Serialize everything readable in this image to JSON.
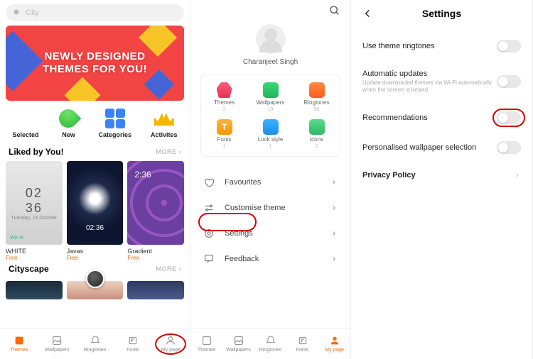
{
  "pane1": {
    "search_placeholder": "City",
    "banner_line1": "NEWLY DESIGNED",
    "banner_line2": "THEMES FOR YOU!",
    "cats": [
      {
        "label": "Selected"
      },
      {
        "label": "New"
      },
      {
        "label": "Categories"
      },
      {
        "label": "Activites"
      }
    ],
    "section1_title": "Liked by You!",
    "more": "MORE",
    "themes": [
      {
        "name": "WHITE",
        "price": "Free",
        "hint": "Win in"
      },
      {
        "name": "Javas",
        "price": "Free"
      },
      {
        "name": "Gradient",
        "price": "Free"
      }
    ],
    "section2_title": "Cityscape",
    "tabs": [
      {
        "label": "Themes"
      },
      {
        "label": "Wallpapers"
      },
      {
        "label": "Ringtones"
      },
      {
        "label": "Fonts"
      },
      {
        "label": "My page"
      }
    ]
  },
  "pane2": {
    "username": "Charanjeet Singh",
    "stats": [
      {
        "label": "Themes",
        "count": "3"
      },
      {
        "label": "Wallpapers",
        "count": "19"
      },
      {
        "label": "Ringtones",
        "count": "56"
      },
      {
        "label": "Fonts",
        "count": "1"
      },
      {
        "label": "Lock style",
        "count": "1"
      },
      {
        "label": "Icons",
        "count": "2"
      }
    ],
    "menu": [
      {
        "label": "Favourites"
      },
      {
        "label": "Customise theme"
      },
      {
        "label": "Settings"
      },
      {
        "label": "Feedback"
      }
    ],
    "tabs": [
      {
        "label": "Themes"
      },
      {
        "label": "Wallpapers"
      },
      {
        "label": "Ringtones"
      },
      {
        "label": "Fonts"
      },
      {
        "label": "My page"
      }
    ]
  },
  "pane3": {
    "title": "Settings",
    "rows": [
      {
        "label": "Use theme ringtones"
      },
      {
        "label": "Automatic updates",
        "sub": "Update downloaded themes via Wi-Fi automatically when the screen is locked"
      },
      {
        "label": "Recommendations"
      },
      {
        "label": "Personalised wallpaper selection"
      },
      {
        "label": "Privacy Policy"
      }
    ]
  }
}
